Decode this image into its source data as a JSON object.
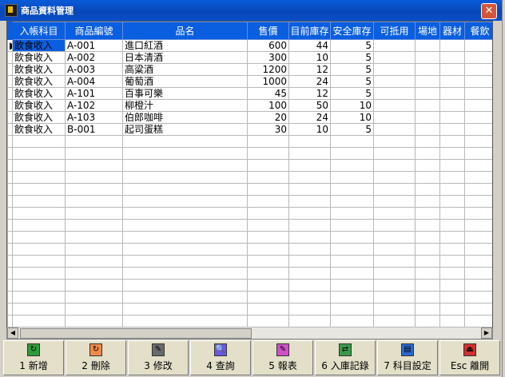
{
  "window": {
    "title": "商品資料管理"
  },
  "grid": {
    "columns": [
      "入帳科目",
      "商品編號",
      "品名",
      "售價",
      "目前庫存",
      "安全庫存",
      "可抵用",
      "場地",
      "器材",
      "餐飲"
    ],
    "rows": [
      [
        "飲食收入",
        "A-001",
        "進口紅酒",
        "600",
        "44",
        "5"
      ],
      [
        "飲食收入",
        "A-002",
        "日本清酒",
        "300",
        "10",
        "5"
      ],
      [
        "飲食收入",
        "A-003",
        "高粱酒",
        "1200",
        "12",
        "5"
      ],
      [
        "飲食收入",
        "A-004",
        "葡萄酒",
        "1000",
        "24",
        "5"
      ],
      [
        "飲食收入",
        "A-101",
        "百事可樂",
        "45",
        "12",
        "5"
      ],
      [
        "飲食收入",
        "A-102",
        "柳橙汁",
        "100",
        "50",
        "10"
      ],
      [
        "飲食收入",
        "A-103",
        "伯郎咖啡",
        "20",
        "24",
        "10"
      ],
      [
        "飲食收入",
        "B-001",
        "起司蛋糕",
        "30",
        "10",
        "5"
      ]
    ]
  },
  "toolbar": {
    "buttons": [
      {
        "label": "1 新增",
        "icon": "add-icon",
        "color": "#2f9a3c"
      },
      {
        "label": "2 刪除",
        "icon": "delete-icon",
        "color": "#f08a4b"
      },
      {
        "label": "3 修改",
        "icon": "edit-icon",
        "color": "#6a6a6a"
      },
      {
        "label": "4 查詢",
        "icon": "search-icon",
        "color": "#6a5ae0"
      },
      {
        "label": "5 報表",
        "icon": "report-icon",
        "color": "#d050c8"
      },
      {
        "label": "6 入庫記錄",
        "icon": "stock-in-icon",
        "color": "#3a9a4a"
      },
      {
        "label": "7 科目設定",
        "icon": "settings-icon",
        "color": "#2a6ad0"
      },
      {
        "label": "Esc 離開",
        "icon": "exit-icon",
        "color": "#d03030"
      }
    ]
  }
}
